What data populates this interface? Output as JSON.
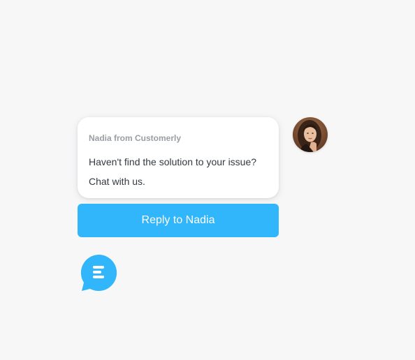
{
  "chat_card": {
    "sender": "Nadia from Customerly",
    "message_line_1": "Haven't find the solution to your issue?",
    "message_line_2": "Chat with us."
  },
  "reply_button": {
    "label": "Reply to Nadia"
  },
  "avatar": {
    "icon": "agent-avatar-photo"
  },
  "launcher": {
    "icon": "chat-bubble-icon",
    "color": "#31b5fb"
  },
  "colors": {
    "accent": "#31b5fb",
    "background": "#f7f7f8",
    "card": "#ffffff",
    "sender_text": "#9a9ea3",
    "message_text": "#333940"
  }
}
